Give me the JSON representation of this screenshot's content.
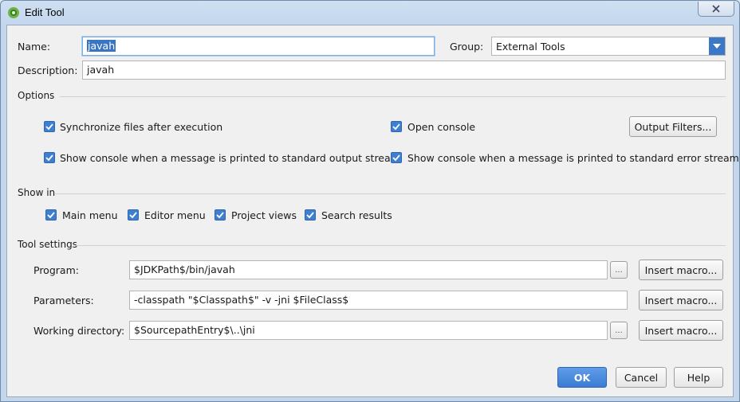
{
  "window": {
    "title": "Edit Tool",
    "close_glyph": "✕"
  },
  "form": {
    "name_label": "Name:",
    "name_value": "javah",
    "group_label": "Group:",
    "group_value": "External Tools",
    "description_label": "Description:",
    "description_value": "javah"
  },
  "options": {
    "section_title": "Options",
    "sync_files": {
      "label": "Synchronize files after execution",
      "checked": true
    },
    "open_console": {
      "label": "Open console",
      "checked": true
    },
    "output_filters_button": "Output Filters...",
    "show_console_stdout": {
      "label": "Show console when a message is printed to standard output stream",
      "checked": true
    },
    "show_console_stderr": {
      "label": "Show console when a message is printed to standard error stream",
      "checked": true
    }
  },
  "show_in": {
    "section_title": "Show in",
    "items": [
      {
        "label": "Main menu",
        "checked": true
      },
      {
        "label": "Editor menu",
        "checked": true
      },
      {
        "label": "Project views",
        "checked": true
      },
      {
        "label": "Search results",
        "checked": true
      }
    ]
  },
  "tool_settings": {
    "section_title": "Tool settings",
    "program_label": "Program:",
    "program_value": "$JDKPath$/bin/javah",
    "parameters_label": "Parameters:",
    "parameters_value": "-classpath \"$Classpath$\" -v -jni $FileClass$",
    "working_dir_label": "Working directory:",
    "working_dir_value": "$SourcepathEntry$\\..\\jni",
    "browse_label": "...",
    "insert_macro_label": "Insert macro..."
  },
  "footer": {
    "ok_label": "OK",
    "cancel_label": "Cancel",
    "help_label": "Help"
  },
  "icons": {
    "app": "android-studio-icon",
    "close": "close-icon",
    "dropdown": "chevron-down-icon",
    "checkbox": "checkmark-icon"
  },
  "colors": {
    "accent": "#3f7fd1",
    "primary_button": "#3b7bd4",
    "selection": "#3a75c4"
  }
}
